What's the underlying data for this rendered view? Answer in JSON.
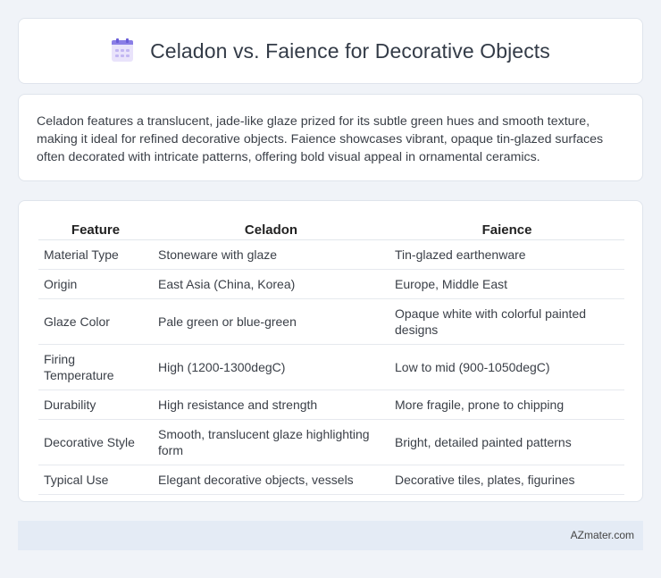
{
  "header": {
    "title": "Celadon vs. Faience for Decorative Objects",
    "icon": "calendar-icon",
    "accent_color": "#8a7ee6"
  },
  "intro": {
    "text": "Celadon features a translucent, jade-like glaze prized for its subtle green hues and smooth texture, making it ideal for refined decorative objects. Faience showcases vibrant, opaque tin-glazed surfaces often decorated with intricate patterns, offering bold visual appeal in ornamental ceramics."
  },
  "table": {
    "headers": [
      "Feature",
      "Celadon",
      "Faience"
    ],
    "rows": [
      [
        "Material Type",
        "Stoneware with glaze",
        "Tin-glazed earthenware"
      ],
      [
        "Origin",
        "East Asia (China, Korea)",
        "Europe, Middle East"
      ],
      [
        "Glaze Color",
        "Pale green or blue-green",
        "Opaque white with colorful painted designs"
      ],
      [
        "Firing Temperature",
        "High (1200-1300degC)",
        "Low to mid (900-1050degC)"
      ],
      [
        "Durability",
        "High resistance and strength",
        "More fragile, prone to chipping"
      ],
      [
        "Decorative Style",
        "Smooth, translucent glaze highlighting form",
        "Bright, detailed painted patterns"
      ],
      [
        "Typical Use",
        "Elegant decorative objects, vessels",
        "Decorative tiles, plates, figurines"
      ]
    ]
  },
  "footer": {
    "text": "AZmater.com"
  }
}
